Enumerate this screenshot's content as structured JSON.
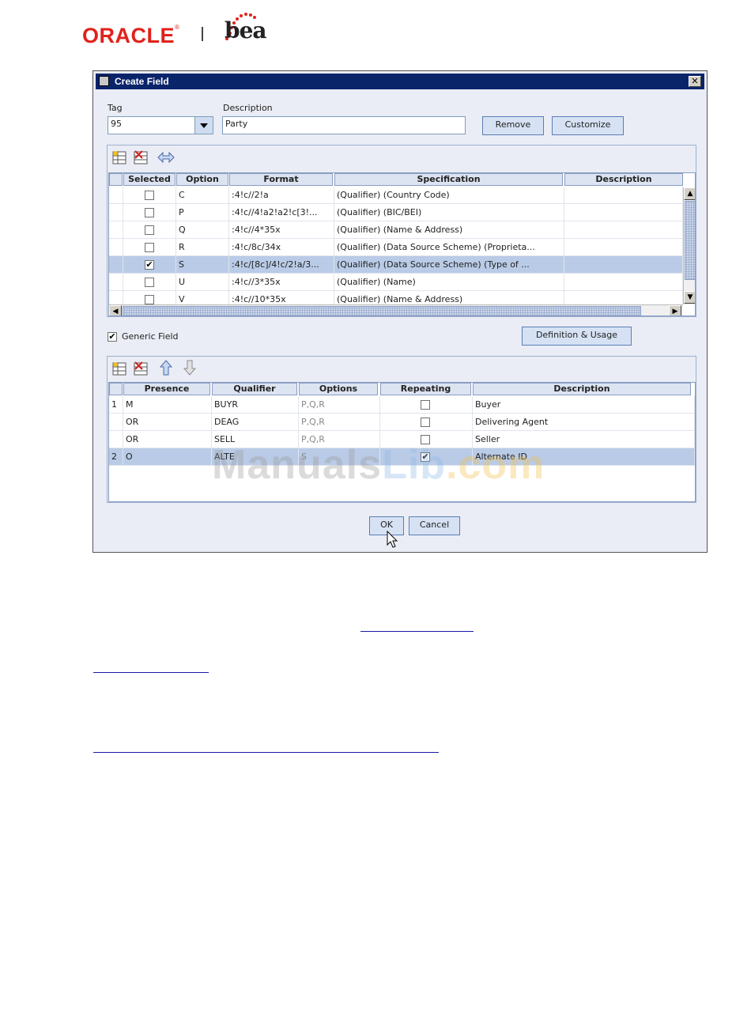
{
  "header": {
    "oracle_logo": "ORACLE",
    "bea_logo": "bea"
  },
  "dialog": {
    "title": "Create Field",
    "close_glyph": "✕",
    "tag_label": "Tag",
    "tag_value": "95",
    "description_label": "Description",
    "description_value": "Party",
    "remove_button": "Remove",
    "customize_button": "Customize",
    "options_table": {
      "columns": [
        "",
        "Selected",
        "Option",
        "Format",
        "Specification",
        "Description"
      ],
      "rows": [
        {
          "selected": false,
          "option": "C",
          "format": ":4!c//2!a",
          "specification": "(Qualifier) (Country Code)",
          "description": ""
        },
        {
          "selected": false,
          "option": "P",
          "format": ":4!c//4!a2!a2!c[3!...",
          "specification": "(Qualifier) (BIC/BEI)",
          "description": ""
        },
        {
          "selected": false,
          "option": "Q",
          "format": ":4!c//4*35x",
          "specification": " (Qualifier) (Name & Address)",
          "description": ""
        },
        {
          "selected": false,
          "option": "R",
          "format": ":4!c/8c/34x",
          "specification": "(Qualifier) (Data Source Scheme) (Proprieta...",
          "description": ""
        },
        {
          "selected": true,
          "option": "S",
          "format": ":4!c/[8c]/4!c/2!a/3...",
          "specification": "(Qualifier) (Data Source Scheme) (Type of ...",
          "description": ""
        },
        {
          "selected": false,
          "option": "U",
          "format": ":4!c//3*35x",
          "specification": "(Qualifier) (Name)",
          "description": ""
        },
        {
          "selected": false,
          "option": "V",
          "format": ":4!c//10*35x",
          "specification": "(Qualifier) (Name & Address)",
          "description": ""
        }
      ]
    },
    "generic_field_label": "Generic Field",
    "generic_field_checked": true,
    "definition_usage_button": "Definition & Usage",
    "qualifier_table": {
      "columns": [
        "",
        "Presence",
        "Qualifier",
        "Options",
        "Repeating",
        "Description"
      ],
      "rows": [
        {
          "num": "1",
          "presence": "M",
          "qualifier": "BUYR",
          "options": "P,Q,R",
          "repeating": false,
          "description": "Buyer"
        },
        {
          "num": "",
          "presence": "OR",
          "qualifier": "DEAG",
          "options": "P,Q,R",
          "repeating": false,
          "description": "Delivering Agent"
        },
        {
          "num": "",
          "presence": "OR",
          "qualifier": "SELL",
          "options": "P,Q,R",
          "repeating": false,
          "description": "Seller"
        },
        {
          "num": "2",
          "presence": "O",
          "qualifier": "ALTE",
          "options": "S",
          "repeating": true,
          "description": "Alternate ID"
        }
      ]
    },
    "ok_button": "OK",
    "cancel_button": "Cancel"
  },
  "watermark": {
    "part1": "Manuals",
    "part2": "Lib",
    "part3": ".com"
  },
  "icons": [
    "window-icon",
    "close-icon",
    "dropdown-arrow-icon",
    "add-row-icon",
    "delete-row-icon",
    "swap-icon",
    "move-up-icon",
    "move-down-icon",
    "scroll-up-icon",
    "scroll-down-icon",
    "scroll-left-icon",
    "scroll-right-icon",
    "mouse-cursor-icon"
  ],
  "colors": {
    "titlebar": "#0a246a",
    "selection": "#b9cbe6",
    "button": "#d6e2f4",
    "oracle_red": "#e0221b"
  }
}
